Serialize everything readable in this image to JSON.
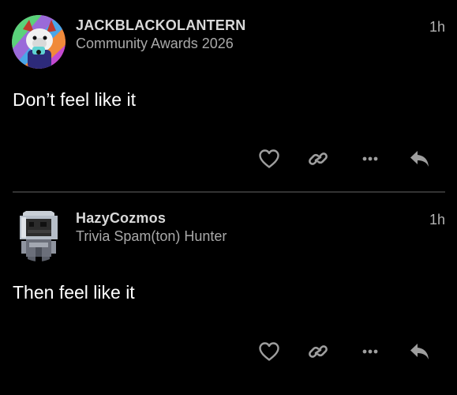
{
  "posts": [
    {
      "username": "JACKBLACKOLANTERN",
      "user_title": "Community Awards 2026",
      "timestamp": "1h",
      "body": "Don’t feel like it",
      "avatar_icon": "fox-character-avatar"
    },
    {
      "username": "HazyCozmos",
      "user_title": "Trivia Spam(ton) Hunter",
      "timestamp": "1h",
      "body": "Then feel like it",
      "avatar_icon": "pixel-astronaut-avatar"
    }
  ],
  "actions": [
    "heart-icon",
    "link-icon",
    "more-icon",
    "reply-icon"
  ],
  "colors": {
    "background": "#000000",
    "username": "#d9d9d9",
    "user_title": "#a9a9a9",
    "body_text": "#ffffff",
    "icon": "#9e9e9e",
    "divider": "#333333"
  }
}
